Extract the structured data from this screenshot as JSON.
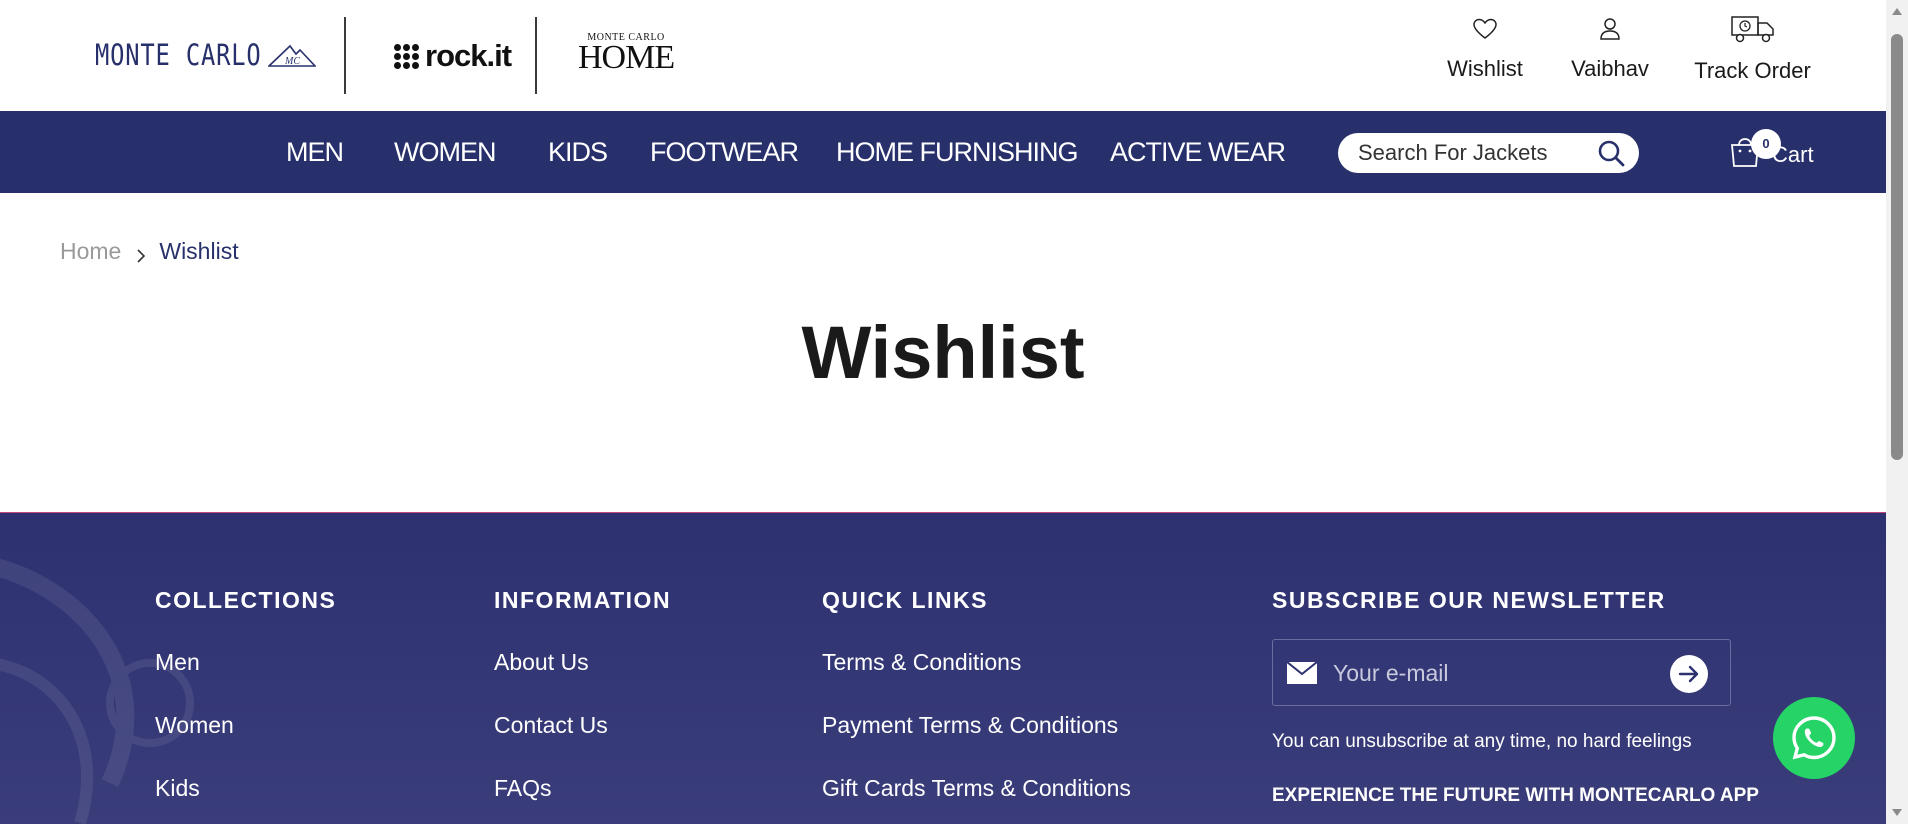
{
  "brands": {
    "montecarlo": "MONTE CARLO",
    "rockit": "rock.it",
    "home_small": "MONTE CARLO",
    "home_big": "HOME"
  },
  "header": {
    "wishlist_label": "Wishlist",
    "account_label": "Vaibhav",
    "track_label": "Track Order"
  },
  "nav": {
    "items": [
      "MEN",
      "WOMEN",
      "KIDS",
      "FOOTWEAR",
      "HOME FURNISHING",
      "ACTIVE WEAR"
    ],
    "search_placeholder": "Search For Jackets",
    "cart_count": "0",
    "cart_label": "Cart"
  },
  "breadcrumb": {
    "home": "Home",
    "current": "Wishlist"
  },
  "page_title": "Wishlist",
  "footer": {
    "collections": {
      "heading": "COLLECTIONS",
      "links": [
        "Men",
        "Women",
        "Kids"
      ]
    },
    "information": {
      "heading": "INFORMATION",
      "links": [
        "About Us",
        "Contact Us",
        "FAQs"
      ]
    },
    "quick_links": {
      "heading": "QUICK LINKS",
      "links": [
        "Terms & Conditions",
        "Payment Terms & Conditions",
        "Gift Cards Terms & Conditions"
      ]
    },
    "newsletter": {
      "heading": "SUBSCRIBE OUR NEWSLETTER",
      "placeholder": "Your e-mail",
      "note": "You can unsubscribe at any time, no hard feelings",
      "app_text": "EXPERIENCE THE FUTURE WITH MONTECARLO APP"
    }
  },
  "colors": {
    "brand_navy": "#27306b",
    "footer_bg": "#2e3170",
    "whatsapp_green": "#25d366"
  },
  "icons": [
    "heart-icon",
    "user-icon",
    "truck-icon",
    "search-icon",
    "cart-bag-icon",
    "chevron-right-icon",
    "mail-icon",
    "arrow-right-icon",
    "whatsapp-icon"
  ]
}
